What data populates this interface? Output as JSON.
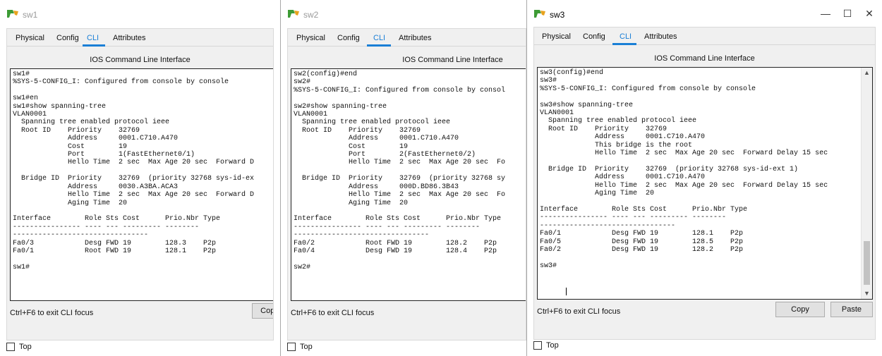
{
  "windows": [
    {
      "title": "sw1",
      "active": false,
      "tabs": [
        "Physical",
        "Config",
        "CLI",
        "Attributes"
      ],
      "cli_heading": "IOS Command Line Interface",
      "terminal": "sw1#\n%SYS-5-CONFIG_I: Configured from console by console\n\nsw1#en\nsw1#show spanning-tree\nVLAN0001\n  Spanning tree enabled protocol ieee\n  Root ID    Priority    32769\n             Address     0001.C710.A470\n             Cost        19\n             Port        1(FastEthernet0/1)\n             Hello Time  2 sec  Max Age 20 sec  Forward D\n\n  Bridge ID  Priority    32769  (priority 32768 sys-id-ex\n             Address     0030.A3BA.ACA3\n             Hello Time  2 sec  Max Age 20 sec  Forward D\n             Aging Time  20\n\nInterface        Role Sts Cost      Prio.Nbr Type\n---------------- ---- --- --------- --------\n--------------------------------\nFa0/3            Desg FWD 19        128.3    P2p\nFa0/1            Root FWD 19        128.1    P2p\n\nsw1#",
      "focus_hint": "Ctrl+F6 to exit CLI focus",
      "buttons": [
        "Copy"
      ],
      "top_label": "Top"
    },
    {
      "title": "sw2",
      "active": false,
      "tabs": [
        "Physical",
        "Config",
        "CLI",
        "Attributes"
      ],
      "cli_heading": "IOS Command Line Interface",
      "terminal": "sw2(config)#end\nsw2#\n%SYS-5-CONFIG_I: Configured from console by consol\n\nsw2#show spanning-tree\nVLAN0001\n  Spanning tree enabled protocol ieee\n  Root ID    Priority    32769\n             Address     0001.C710.A470\n             Cost        19\n             Port        2(FastEthernet0/2)\n             Hello Time  2 sec  Max Age 20 sec  Fo\n\n  Bridge ID  Priority    32769  (priority 32768 sy\n             Address     000D.BD86.3B43\n             Hello Time  2 sec  Max Age 20 sec  Fo\n             Aging Time  20\n\nInterface        Role Sts Cost      Prio.Nbr Type\n---------------- ---- --- --------- --------\n--------------------------------\nFa0/2            Root FWD 19        128.2    P2p\nFa0/4            Desg FWD 19        128.4    P2p\n\nsw2#",
      "focus_hint": "Ctrl+F6 to exit CLI focus",
      "buttons": [],
      "top_label": "Top"
    },
    {
      "title": "sw3",
      "active": true,
      "tabs": [
        "Physical",
        "Config",
        "CLI",
        "Attributes"
      ],
      "cli_heading": "IOS Command Line Interface",
      "terminal": "sw3(config)#end\nsw3#\n%SYS-5-CONFIG_I: Configured from console by console\n\nsw3#show spanning-tree\nVLAN0001\n  Spanning tree enabled protocol ieee\n  Root ID    Priority    32769\n             Address     0001.C710.A470\n             This bridge is the root\n             Hello Time  2 sec  Max Age 20 sec  Forward Delay 15 sec\n\n  Bridge ID  Priority    32769  (priority 32768 sys-id-ext 1)\n             Address     0001.C710.A470\n             Hello Time  2 sec  Max Age 20 sec  Forward Delay 15 sec\n             Aging Time  20\n\nInterface        Role Sts Cost      Prio.Nbr Type\n---------------- ---- --- --------- --------\n--------------------------------\nFa0/1            Desg FWD 19        128.1    P2p\nFa0/5            Desg FWD 19        128.5    P2p\nFa0/2            Desg FWD 19        128.2    P2p\n\nsw3#",
      "focus_hint": "Ctrl+F6 to exit CLI focus",
      "buttons": [
        "Copy",
        "Paste"
      ],
      "top_label": "Top",
      "window_controls": [
        "—",
        "☐",
        "✕"
      ],
      "scrollbar": {
        "up_icon": "▲",
        "down_icon": "▼"
      }
    }
  ],
  "colors": {
    "accent": "#1a7fd6",
    "client_bg": "#f0f0f0",
    "terminal_bg": "#ffffff"
  }
}
